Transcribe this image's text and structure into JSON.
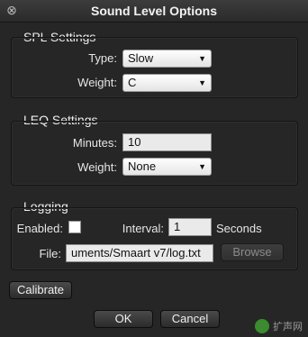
{
  "window": {
    "title": "Sound Level Options",
    "close_glyph": "⊗"
  },
  "spl_settings": {
    "title": "SPL Settings",
    "type_label": "Type:",
    "type_value": "Slow",
    "weight_label": "Weight:",
    "weight_value": "C"
  },
  "leq_settings": {
    "title": "LEQ Settings",
    "minutes_label": "Minutes:",
    "minutes_value": "10",
    "weight_label": "Weight:",
    "weight_value": "None"
  },
  "logging": {
    "title": "Logging",
    "enabled_label": "Enabled:",
    "enabled_checked": false,
    "interval_label": "Interval:",
    "interval_value": "1",
    "interval_unit": "Seconds",
    "file_label": "File:",
    "file_value": "uments/Smaart v7/log.txt",
    "browse_label": "Browse"
  },
  "buttons": {
    "calibrate_label": "Calibrate",
    "ok_label": "OK",
    "cancel_label": "Cancel"
  },
  "watermark": {
    "text": "扩声网"
  },
  "icons": {
    "dropdown": "chevron-down-icon"
  }
}
